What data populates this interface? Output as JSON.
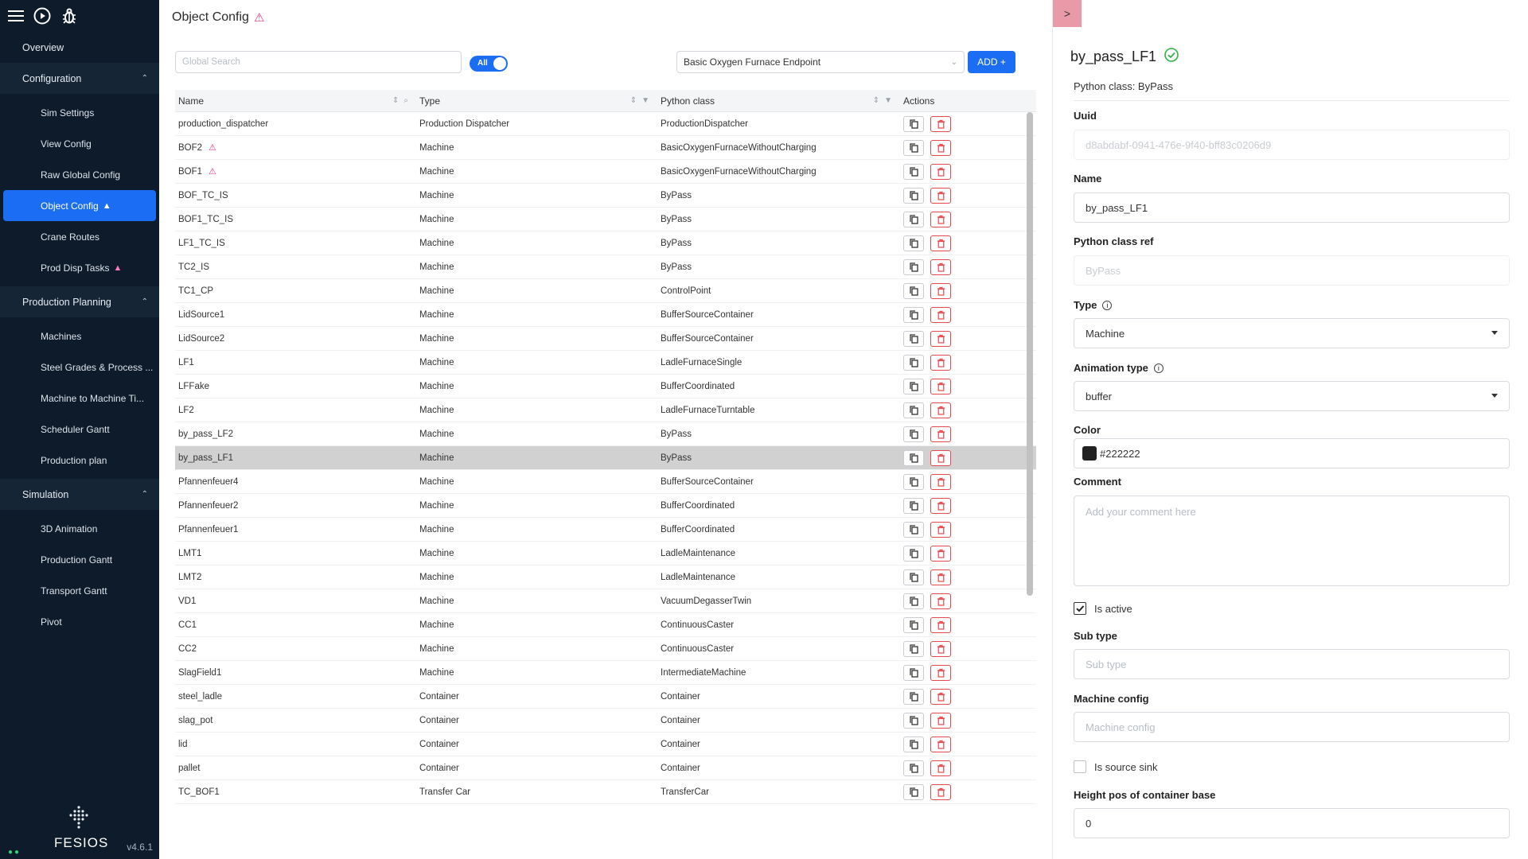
{
  "sidebar": {
    "top_icons": [
      "menu-icon",
      "play-circle-icon",
      "bug-icon"
    ],
    "overview": "Overview",
    "sections": [
      {
        "label": "Configuration",
        "items": [
          {
            "label": "Sim Settings",
            "warn": false,
            "active": false
          },
          {
            "label": "View Config",
            "warn": false,
            "active": false
          },
          {
            "label": "Raw Global Config",
            "warn": false,
            "active": false
          },
          {
            "label": "Object Config",
            "warn": true,
            "active": true
          },
          {
            "label": "Crane Routes",
            "warn": false,
            "active": false
          },
          {
            "label": "Prod Disp Tasks",
            "warn": true,
            "active": false
          }
        ]
      },
      {
        "label": "Production Planning",
        "items": [
          {
            "label": "Machines",
            "warn": false,
            "active": false
          },
          {
            "label": "Steel Grades & Process ...",
            "warn": false,
            "active": false
          },
          {
            "label": "Machine to Machine Ti...",
            "warn": false,
            "active": false
          },
          {
            "label": "Scheduler Gantt",
            "warn": false,
            "active": false
          },
          {
            "label": "Production plan",
            "warn": false,
            "active": false
          }
        ]
      },
      {
        "label": "Simulation",
        "items": [
          {
            "label": "3D Animation",
            "warn": false,
            "active": false
          },
          {
            "label": "Production Gantt",
            "warn": false,
            "active": false
          },
          {
            "label": "Transport Gantt",
            "warn": false,
            "active": false
          },
          {
            "label": "Pivot",
            "warn": false,
            "active": false
          }
        ]
      }
    ],
    "brand": "FESIOS",
    "version": "v4.6.1"
  },
  "main": {
    "title": "Object Config",
    "search_placeholder": "Global Search",
    "toggle_label": "All",
    "endpoint": "Basic Oxygen Furnace Endpoint",
    "add_label": "ADD +",
    "columns": [
      "Name",
      "Type",
      "Python class",
      "Actions"
    ],
    "rows": [
      {
        "name": "production_dispatcher",
        "warn": false,
        "type": "Production Dispatcher",
        "py": "ProductionDispatcher",
        "selected": false
      },
      {
        "name": "BOF2",
        "warn": true,
        "type": "Machine",
        "py": "BasicOxygenFurnaceWithoutCharging",
        "selected": false
      },
      {
        "name": "BOF1",
        "warn": true,
        "type": "Machine",
        "py": "BasicOxygenFurnaceWithoutCharging",
        "selected": false
      },
      {
        "name": "BOF_TC_IS",
        "warn": false,
        "type": "Machine",
        "py": "ByPass",
        "selected": false
      },
      {
        "name": "BOF1_TC_IS",
        "warn": false,
        "type": "Machine",
        "py": "ByPass",
        "selected": false
      },
      {
        "name": "LF1_TC_IS",
        "warn": false,
        "type": "Machine",
        "py": "ByPass",
        "selected": false
      },
      {
        "name": "TC2_IS",
        "warn": false,
        "type": "Machine",
        "py": "ByPass",
        "selected": false
      },
      {
        "name": "TC1_CP",
        "warn": false,
        "type": "Machine",
        "py": "ControlPoint",
        "selected": false
      },
      {
        "name": "LidSource1",
        "warn": false,
        "type": "Machine",
        "py": "BufferSourceContainer",
        "selected": false
      },
      {
        "name": "LidSource2",
        "warn": false,
        "type": "Machine",
        "py": "BufferSourceContainer",
        "selected": false
      },
      {
        "name": "LF1",
        "warn": false,
        "type": "Machine",
        "py": "LadleFurnaceSingle",
        "selected": false
      },
      {
        "name": "LFFake",
        "warn": false,
        "type": "Machine",
        "py": "BufferCoordinated",
        "selected": false
      },
      {
        "name": "LF2",
        "warn": false,
        "type": "Machine",
        "py": "LadleFurnaceTurntable",
        "selected": false
      },
      {
        "name": "by_pass_LF2",
        "warn": false,
        "type": "Machine",
        "py": "ByPass",
        "selected": false
      },
      {
        "name": "by_pass_LF1",
        "warn": false,
        "type": "Machine",
        "py": "ByPass",
        "selected": true
      },
      {
        "name": "Pfannenfeuer4",
        "warn": false,
        "type": "Machine",
        "py": "BufferSourceContainer",
        "selected": false
      },
      {
        "name": "Pfannenfeuer2",
        "warn": false,
        "type": "Machine",
        "py": "BufferCoordinated",
        "selected": false
      },
      {
        "name": "Pfannenfeuer1",
        "warn": false,
        "type": "Machine",
        "py": "BufferCoordinated",
        "selected": false
      },
      {
        "name": "LMT1",
        "warn": false,
        "type": "Machine",
        "py": "LadleMaintenance",
        "selected": false
      },
      {
        "name": "LMT2",
        "warn": false,
        "type": "Machine",
        "py": "LadleMaintenance",
        "selected": false
      },
      {
        "name": "VD1",
        "warn": false,
        "type": "Machine",
        "py": "VacuumDegasserTwin",
        "selected": false
      },
      {
        "name": "CC1",
        "warn": false,
        "type": "Machine",
        "py": "ContinuousCaster",
        "selected": false
      },
      {
        "name": "CC2",
        "warn": false,
        "type": "Machine",
        "py": "ContinuousCaster",
        "selected": false
      },
      {
        "name": "SlagField1",
        "warn": false,
        "type": "Machine",
        "py": "IntermediateMachine",
        "selected": false
      },
      {
        "name": "steel_ladle",
        "warn": false,
        "type": "Container",
        "py": "Container",
        "selected": false
      },
      {
        "name": "slag_pot",
        "warn": false,
        "type": "Container",
        "py": "Container",
        "selected": false
      },
      {
        "name": "lid",
        "warn": false,
        "type": "Container",
        "py": "Container",
        "selected": false
      },
      {
        "name": "pallet",
        "warn": false,
        "type": "Container",
        "py": "Container",
        "selected": false
      },
      {
        "name": "TC_BOF1",
        "warn": false,
        "type": "Transfer Car",
        "py": "TransferCar",
        "selected": false
      }
    ]
  },
  "panel": {
    "collapse_label": ">",
    "title": "by_pass_LF1",
    "python_class": "Python class: ByPass",
    "uuid_label": "Uuid",
    "uuid_value": "d8abdabf-0941-476e-9f40-bff83c0206d9",
    "name_label": "Name",
    "name_value": "by_pass_LF1",
    "pyref_label": "Python class ref",
    "pyref_value": "ByPass",
    "type_label": "Type",
    "type_value": "Machine",
    "anim_label": "Animation type",
    "anim_value": "buffer",
    "color_label": "Color",
    "color_value": "#222222",
    "comment_label": "Comment",
    "comment_placeholder": "Add your comment here",
    "is_active_label": "Is active",
    "subtype_label": "Sub type",
    "subtype_placeholder": "Sub type",
    "machine_config_label": "Machine config",
    "machine_config_placeholder": "Machine config",
    "is_source_sink_label": "Is source sink",
    "height_label": "Height pos of container base",
    "height_value": "0"
  },
  "colors": {
    "sidebar_bg": "#0d1b2a",
    "accent": "#1b6ef3",
    "warning": "#e0338c",
    "delete": "#e5484d",
    "success": "#2fb344",
    "selected_row": "#d1d1d1"
  }
}
